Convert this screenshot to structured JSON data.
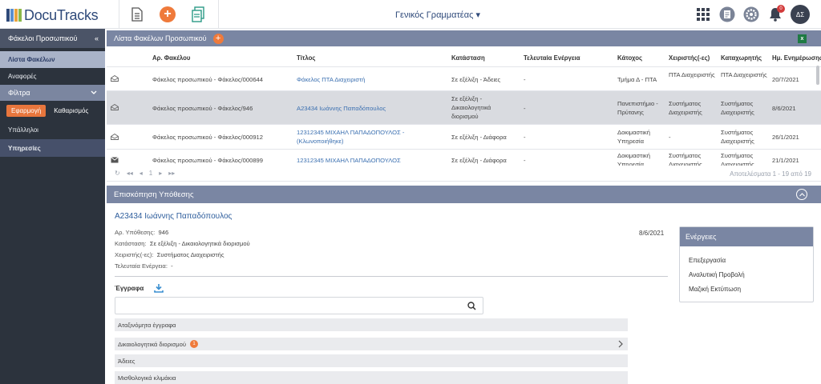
{
  "app": {
    "logo_text": "DocuTracks",
    "role": "Γενικός Γραμματέας",
    "notification_count": "0",
    "avatar_initials": "ΔΣ",
    "colors": {
      "accent": "#ef7a3b",
      "primary": "#2f4a7a",
      "panel_header": "#7a86a3",
      "sidebar": "#2c333d"
    }
  },
  "sidebar": {
    "title": "Φάκελοι Προσωπικού",
    "collapse_symbol": "«",
    "items": [
      {
        "label": "Λίστα Φακέλων"
      },
      {
        "label": "Αναφορές"
      }
    ],
    "filters_label": "Φίλτρα",
    "apply_label": "Εφαρμογή",
    "clear_label": "Καθαρισμός",
    "filter_items": [
      {
        "label": "Υπάλληλοι"
      },
      {
        "label": "Υπηρεσίες"
      }
    ]
  },
  "list": {
    "title": "Λίστα Φακέλων Προσωπικού",
    "columns": [
      "Αρ. Φακέλου",
      "Τίτλος",
      "Κατάσταση",
      "Τελευταία Ενέργεια",
      "Κάτοχος",
      "Χειριστής(-ες)",
      "Καταχωρητής",
      "Ημ. Ενημέρωσης"
    ],
    "rows": [
      {
        "number": "Φάκελος προσωπικού - Φάκελος/000644",
        "title": "Φάκελος ΠΤΑ Διαχειριστή",
        "status": "Σε εξέλιξη - Άδειες",
        "last_action": "-",
        "holder": "Τμήμα Δ - ΠΤΑ",
        "handler": "ΠΤΑ Διαχειριστής",
        "registrar": "ΠΤΑ Διαχειριστής",
        "updated": "20/7/2021"
      },
      {
        "number": "Φάκελος προσωπικού - Φάκελος/946",
        "title": "A23434 Ιωάννης Παπαδόπουλος",
        "status": "Σε εξέλιξη - Δικαιολογητικά διορισμού",
        "last_action": "-",
        "holder": "Πανεπιστήμιο - Πρύτανης",
        "handler": "Συστήματος Διαχειριστής",
        "registrar": "Συστήματος Διαχειριστής",
        "updated": "8/6/2021"
      },
      {
        "number": "Φάκελος προσωπικού - Φάκελος/000912",
        "title": "12312345 ΜΙΧΑΗΛ ΠΑΠΑΔΟΠΟΥΛΟΣ - (Κλωνοποιήθηκε)",
        "status": "Σε εξέλιξη - Διάφορα",
        "last_action": "-",
        "holder": "Δοκιμαστική Υπηρεσία",
        "handler": "-",
        "registrar": "Συστήματος Διαχειριστής",
        "updated": "26/1/2021"
      },
      {
        "number": "Φάκελος προσωπικού - Φάκελος/000899",
        "title": "12312345 ΜΙΧΑΗΛ ΠΑΠΑΔΟΠΟΥΛΟΣ",
        "status": "Σε εξέλιξη - Διάφορα",
        "last_action": "-",
        "holder": "Δοκιμαστική Υπηρεσία",
        "handler": "Συστήματος Διαχειριστής",
        "registrar": "Συστήματος Διαχειριστής",
        "updated": "21/1/2021"
      }
    ],
    "pager": {
      "page": "1",
      "results": "Αποτελέσματα 1 - 19 από 19"
    }
  },
  "overview": {
    "title": "Επισκόπηση Υπόθεσης",
    "case_title": "A23434 Ιωάννης Παπαδόπουλος",
    "fields": [
      {
        "label": "Αρ. Υπόθεσης:",
        "value": "946"
      },
      {
        "label": "Κατάσταση:",
        "value": "Σε εξέλιξη - Δικαιολογητικά διορισμού"
      },
      {
        "label": "Χειριστής(-ες):",
        "value": "Συστήματος Διαχειριστής"
      },
      {
        "label": "Τελευταία Ενέργεια:",
        "value": "-"
      }
    ],
    "date": "8/6/2021",
    "documents_label": "Έγγραφα",
    "search_placeholder": "",
    "categories": [
      {
        "label": "Αταξινόμητα έγγραφα",
        "count": ""
      },
      {
        "label": "Δικαιολογητικά διορισμού",
        "count": "1"
      },
      {
        "label": "Άδειες",
        "count": ""
      },
      {
        "label": "Μισθολογικά κλιμάκια",
        "count": ""
      }
    ],
    "actions_title": "Ενέργειες",
    "actions": [
      "Επεξεργασία",
      "Αναλυτική Προβολή",
      "Μαζική Εκτύπωση"
    ]
  }
}
